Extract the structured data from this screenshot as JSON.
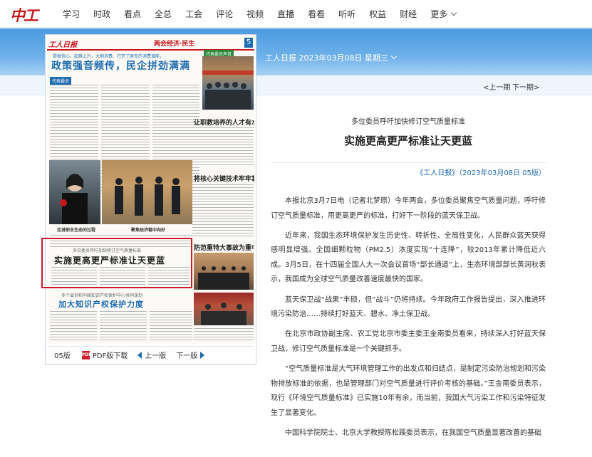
{
  "site": {
    "logo": "中工网",
    "nav": [
      "学习",
      "时政",
      "看点",
      "全总",
      "工会",
      "评论",
      "视频",
      "直播",
      "看看",
      "听听",
      "权益",
      "财经",
      "更多"
    ]
  },
  "issue_label": "工人日报 2023年03月08日 星期三",
  "page_nav": {
    "prev": "<上一期",
    "next": "下一期>"
  },
  "paper": {
    "masthead": "工人日报",
    "section": "两会经济·民生",
    "page_number": "5",
    "kicker": "提振信心、起跳上升，大刷消费、打开了原先的消费潜能，",
    "headline": "政策强音频传，民企拼劲满满",
    "tag_left": "代表委员",
    "tag_right": "代表委员声音",
    "story2": "让职教培养的人才有水平有尊严",
    "story3": "将核心关键技术牢牢掌握在手里",
    "story4": "防范重特大事故为重中之重",
    "caption1": "走进职业生态的过程",
    "caption2": "聚焦经济稳中向好",
    "highlight_kicker": "多位委员呼吁加快修订空气质量标准",
    "highlight_title": "实施更高更严标准让天更蓝",
    "story5_kicker": "多个省份和中国知识产权保护中心共同谋划",
    "story5": "加大知识产权保护力度",
    "footer": {
      "edition": "05版",
      "pdf": "PDF版下载",
      "prev": "上一版",
      "next": "下一版"
    }
  },
  "article": {
    "subhead": "多位委员呼吁加快修订空气质量标准",
    "title": "实施更高更严标准让天更蓝",
    "source": "《工人日报》（2023年03月08日 05版）",
    "paragraphs": [
      "本报北京3月7日电（记者北梦原）今年两会，多位委员聚焦空气质量问题，呼吁修订空气质量标准，用更高更严的标准，打好下一阶段的蓝天保卫战。",
      "近年来，我国生态环境保护发生历史性、转折性、全局性变化，人民群众蓝天获得感明显增强。全国细颗粒物（PM2.5）浓度实现“十连降”，较2013年累计降低近六成。3月5日，在十四届全国人大一次会议首场“部长通道”上，生态环境部部长黄润秋表示，我国成为全球空气质量改善速度最快的国家。",
      "蓝天保卫战“战果”丰硕，但“战斗”仍将持续。今年政府工作报告提出，深入推进环境污染防治……持续打好蓝天、碧水、净土保卫战。",
      "在北京市政协副主席、农工党北京市委主委王金南委员看来，持续深入打好蓝天保卫战，修订空气质量标准是一个关键抓手。",
      "“空气质量标准是大气环境管理工作的出发点和归结点，是制定污染防治规划和污染物排放标准的依据，也是管理部门对空气质量进行评价考核的基础。”王金南委员表示，现行《环境空气质量标准》已实施10年有余，而当前，我国大气污染工作和污染特征发生了显著变化。",
      "中国科学院院士、北京大学教授陈松蹊委员表示，在我国空气质量显著改善的基础"
    ]
  },
  "colors": {
    "brand": "#c8161d",
    "link": "#1e6bb0",
    "highlight_box": "#d0192a"
  }
}
